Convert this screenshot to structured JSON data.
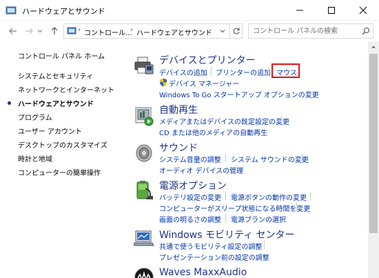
{
  "window": {
    "title": "ハードウェアとサウンド"
  },
  "address": {
    "crumbs": [
      "コントロール...",
      "ハードウェアとサウンド"
    ]
  },
  "search": {
    "placeholder": "コントロール パネルの検索"
  },
  "sidebar": {
    "items": [
      {
        "label": "コントロール パネル ホーム",
        "active": false
      },
      {
        "label": "システムとセキュリティ",
        "active": false
      },
      {
        "label": "ネットワークとインターネット",
        "active": false
      },
      {
        "label": "ハードウェアとサウンド",
        "active": true
      },
      {
        "label": "プログラム",
        "active": false
      },
      {
        "label": "ユーザー アカウント",
        "active": false
      },
      {
        "label": "デスクトップのカスタマイズ",
        "active": false
      },
      {
        "label": "時計と地域",
        "active": false
      },
      {
        "label": "コンピューターの簡単操作",
        "active": false
      }
    ]
  },
  "categories": {
    "devices": {
      "title": "デバイスとプリンター",
      "links": [
        "デバイスの追加",
        "プリンターの追加",
        "マウス",
        "デバイス マネージャー",
        "Windows To Go スタートアップ オプションの変更"
      ]
    },
    "autoplay": {
      "title": "自動再生",
      "links": [
        "メディアまたはデバイスの既定設定の変更",
        "CD または他のメディアの自動再生"
      ]
    },
    "sound": {
      "title": "サウンド",
      "links": [
        "システム音量の調整",
        "システム サウンドの変更",
        "オーディオ デバイスの管理"
      ]
    },
    "power": {
      "title": "電源オプション",
      "links": [
        "バッテリ設定の変更",
        "電源ボタンの動作の変更",
        "コンピューターがスリープ状態になる時間を変更",
        "画面の明るさの調整",
        "電源プランの選択"
      ]
    },
    "mobility": {
      "title": "Windows モビリティ センター",
      "links": [
        "共通で使うモビリティ設定の調整",
        "プレゼンテーション前の設定の調整"
      ]
    },
    "waves": {
      "title": "Waves MaxxAudio"
    }
  },
  "colors": {
    "title_text": "#1e3287",
    "link": "#0033aa",
    "highlight_box": "#e0151b"
  }
}
